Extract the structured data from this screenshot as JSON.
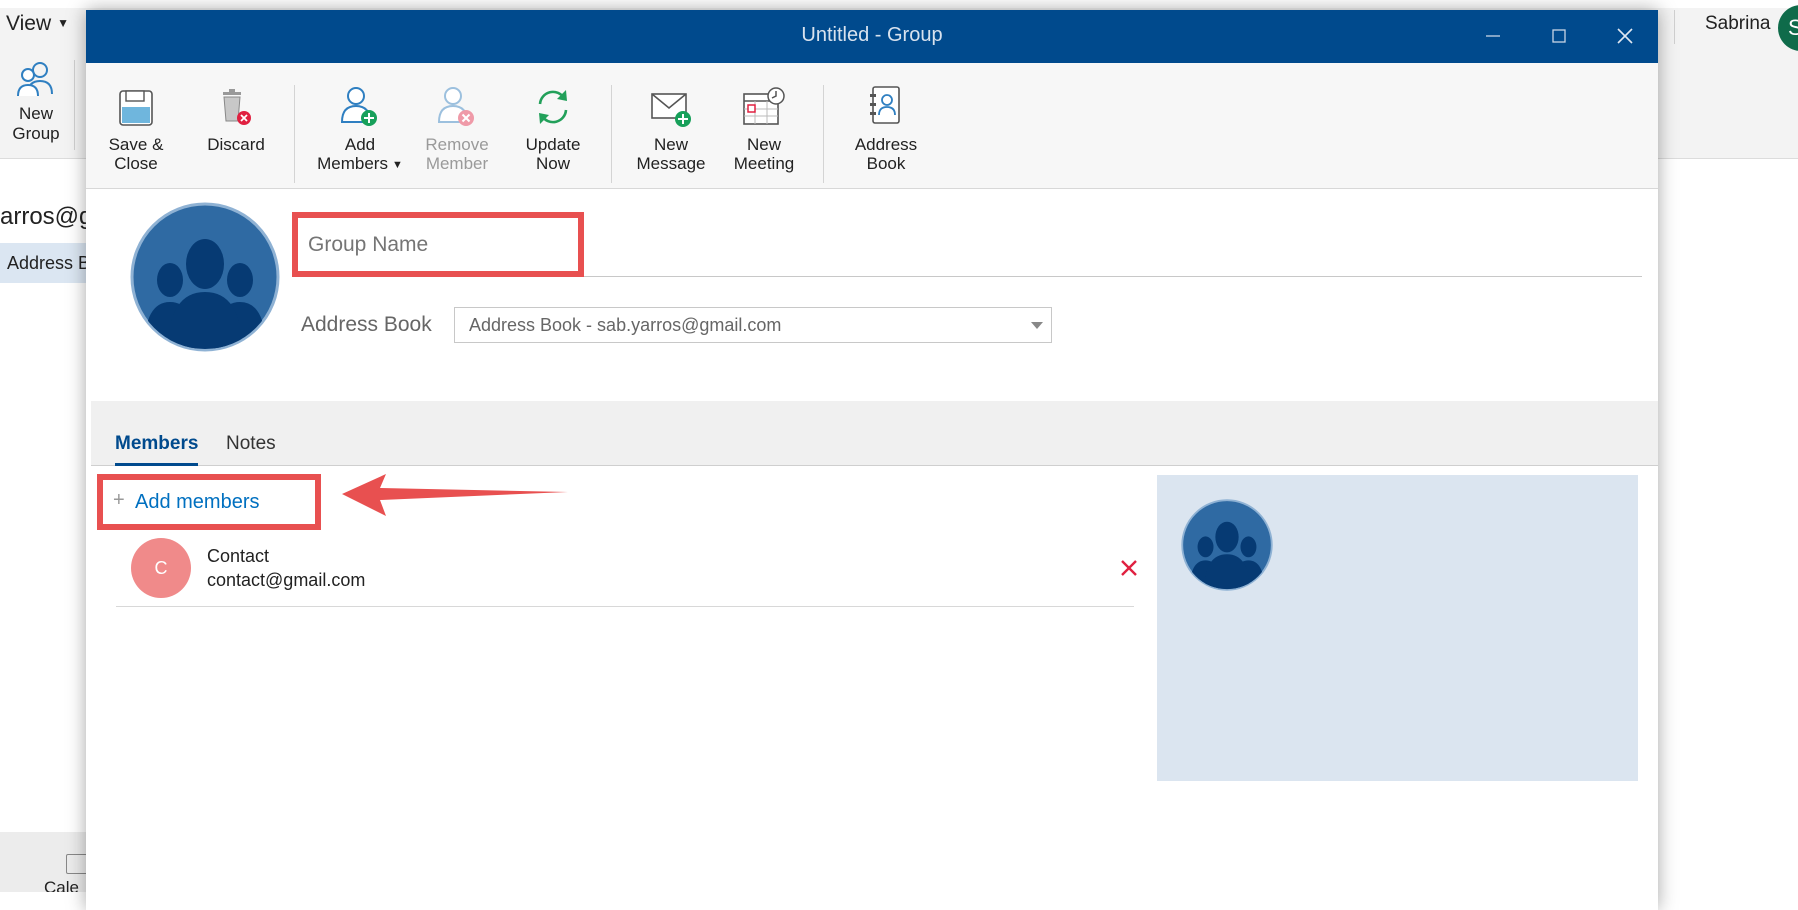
{
  "background_app": {
    "view_menu": "View",
    "new_group_label_line1": "New",
    "new_group_label_line2": "Group",
    "account_email_partial": "arros@g",
    "address_book_item": "Address B",
    "calendar_partial": "Cale",
    "user_name": "Sabrina",
    "user_initial": "S"
  },
  "window": {
    "title": "Untitled - Group"
  },
  "ribbon": {
    "save_close": [
      "Save &",
      "Close"
    ],
    "discard": "Discard",
    "add_members": [
      "Add",
      "Members"
    ],
    "remove_member": [
      "Remove",
      "Member"
    ],
    "update_now": [
      "Update",
      "Now"
    ],
    "new_message": [
      "New",
      "Message"
    ],
    "new_meeting": [
      "New",
      "Meeting"
    ],
    "address_book": [
      "Address",
      "Book"
    ]
  },
  "form": {
    "group_name_placeholder": "Group Name",
    "group_name_value": "",
    "address_book_label": "Address Book",
    "address_book_selected": "Address Book - sab.yarros@gmail.com"
  },
  "tabs": {
    "members": "Members",
    "notes": "Notes"
  },
  "members": {
    "add_members_label": "Add members",
    "plus": "+",
    "list": [
      {
        "initial": "C",
        "name": "Contact",
        "email": "contact@gmail.com"
      }
    ]
  },
  "colors": {
    "title_bar": "#004a8d",
    "highlight_annotation": "#e85050",
    "link": "#0070c0",
    "member_avatar": "#f08a8a",
    "preview_panel": "#dbe5f0"
  }
}
